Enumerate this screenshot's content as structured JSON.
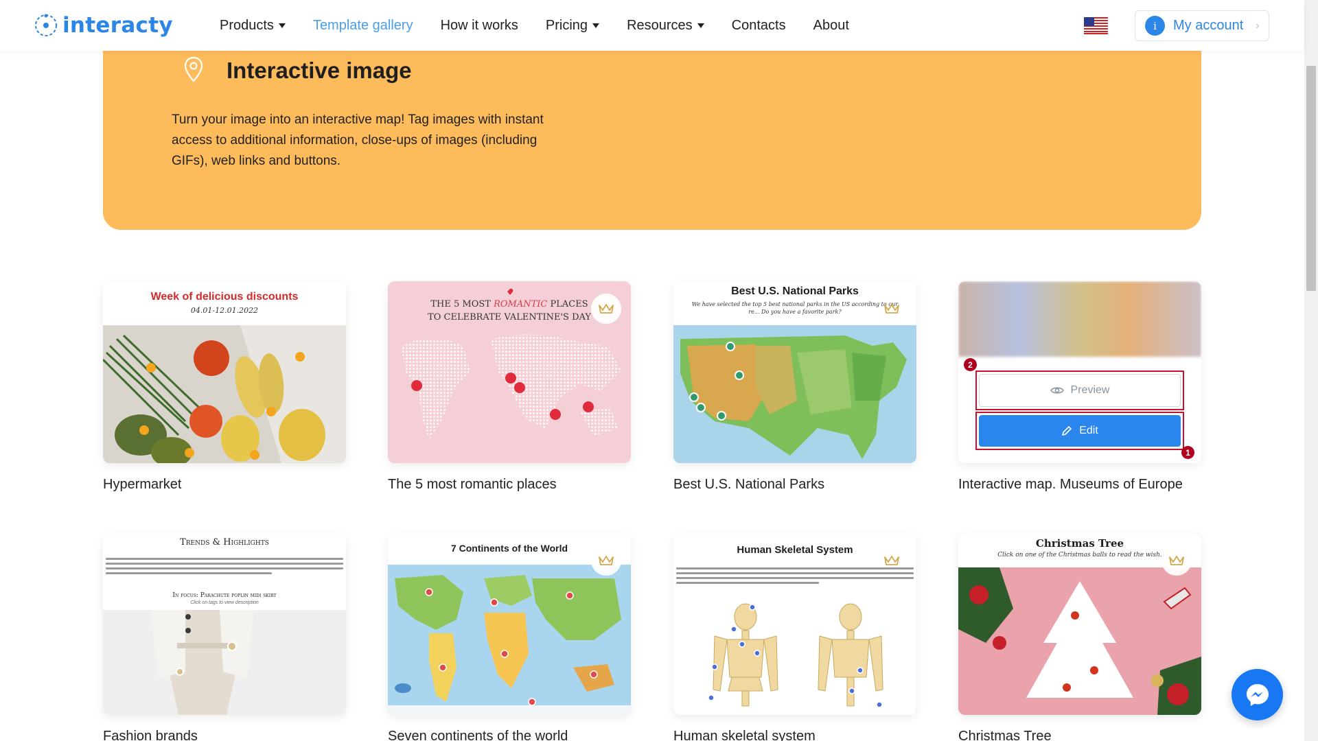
{
  "header": {
    "logo_text": "interacty",
    "nav": [
      {
        "label": "Products",
        "dropdown": true
      },
      {
        "label": "Template gallery",
        "active": true
      },
      {
        "label": "How it works"
      },
      {
        "label": "Pricing",
        "dropdown": true
      },
      {
        "label": "Resources",
        "dropdown": true
      },
      {
        "label": "Contacts"
      },
      {
        "label": "About"
      }
    ],
    "account": {
      "avatar_letter": "i",
      "label": "My account"
    }
  },
  "hero": {
    "title": "Interactive image",
    "description": "Turn your image into an interactive map! Tag images with instant access to additional information, close-ups of images (including GIFs), web links and buttons.",
    "bg_color": "#fdbb5b"
  },
  "cards": [
    {
      "title": "Hypermarket",
      "thumb_title": "Week of delicious discounts",
      "thumb_subtitle": "04.01-12.01.2022"
    },
    {
      "title": "The 5 most romantic places",
      "thumb_title_1": "THE 5 MOST",
      "thumb_title_em": "ROMANTIC",
      "thumb_title_2": "PLACES",
      "thumb_title_3": "TO CELEBRATE VALENTINE'S DAY"
    },
    {
      "title": "Best U.S. National Parks",
      "thumb_title": "Best U.S. National Parks",
      "thumb_subtitle": "We have selected the top 5 best national parks in the US according to our re... Do you have a favorite park?"
    },
    {
      "title": "Interactive map. Museums of Europe",
      "preview_label": "Preview",
      "edit_label": "Edit",
      "badge_1": "1",
      "badge_2": "2"
    },
    {
      "title": "Fashion brands",
      "thumb_title": "Trends & Highlights",
      "thumb_subtitle": "In focus: Parachute poplin midi skirt",
      "thumb_hint": "Click on tags to view description"
    },
    {
      "title": "Seven continents of the world",
      "thumb_title": "7 Continents of the World"
    },
    {
      "title": "Human skeletal system",
      "thumb_title": "Human Skeletal System"
    },
    {
      "title": "Christmas Tree",
      "thumb_title": "Christmas Tree",
      "thumb_subtitle": "Click on one of the Christmas balls to read the wish."
    }
  ],
  "colors": {
    "brand": "#2b86e6",
    "accent": "#4a9ee8",
    "highlight": "#c8102e"
  },
  "icons": [
    "location-pin-icon",
    "crown-icon",
    "eye-icon",
    "pencil-icon",
    "messenger-icon",
    "us-flag-icon"
  ]
}
